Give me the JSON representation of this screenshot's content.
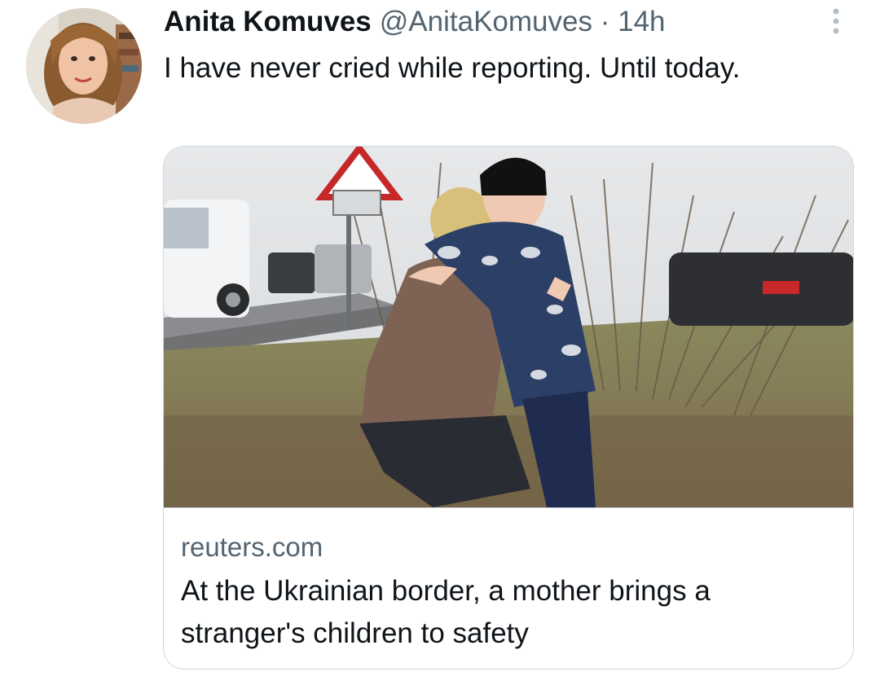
{
  "tweet": {
    "author_name": "Anita Komuves",
    "author_handle": "@AnitaKomuves",
    "separator": "·",
    "timestamp": "14h",
    "text": "I have never cried while reporting. Until today."
  },
  "card": {
    "domain": "reuters.com",
    "title": "At the Ukrainian border, a mother brings a stranger's children to safety"
  },
  "icons": {
    "more": "more-vertical-icon"
  },
  "colors": {
    "text_primary": "#0f1419",
    "text_secondary": "#536471",
    "border": "#cfd9de"
  }
}
